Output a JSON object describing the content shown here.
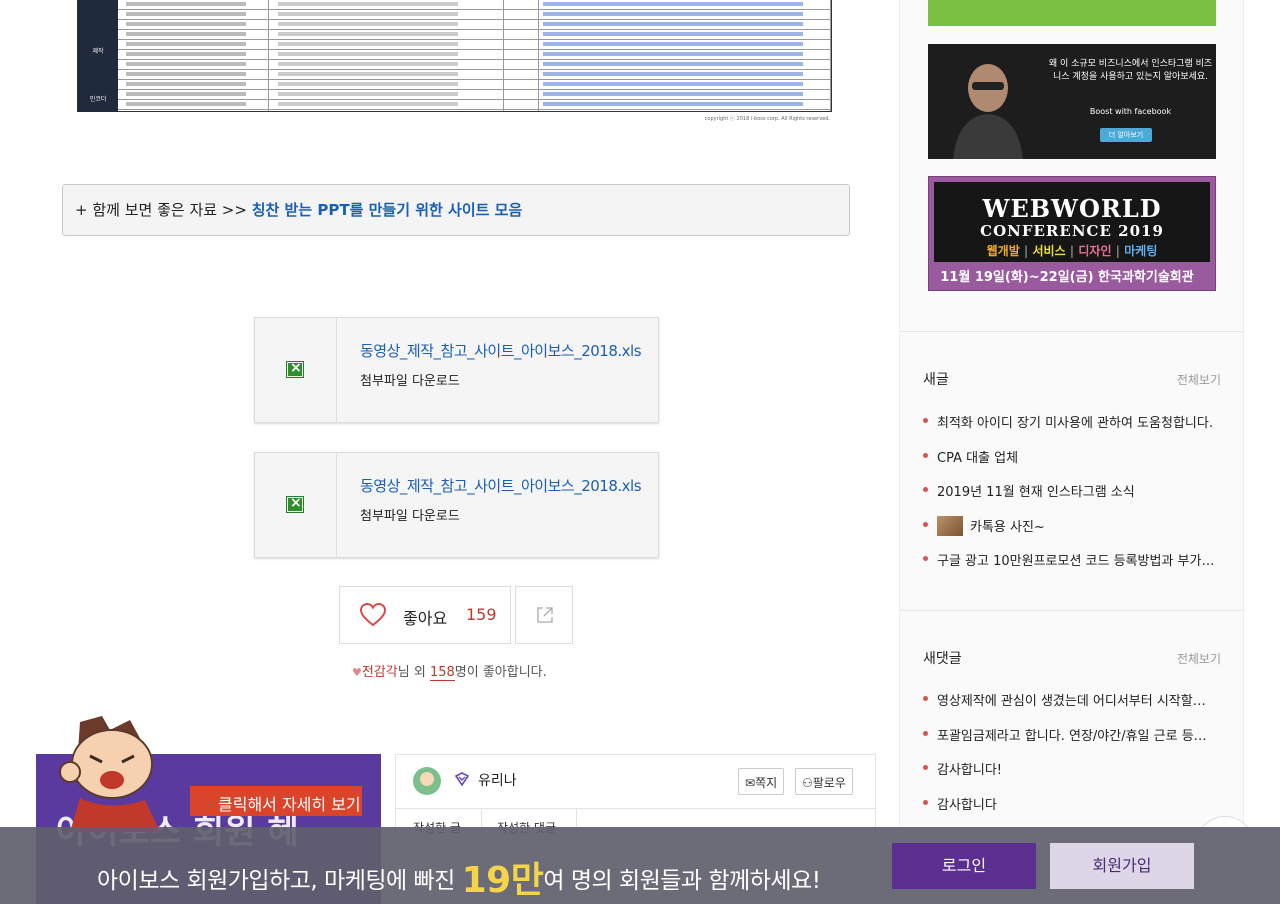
{
  "table_image": {
    "categories": [
      "제작",
      "인코더"
    ],
    "copyright": "copyright ⓒ 2018 i-boss corp. All Rights reserved."
  },
  "related": {
    "prefix": "+ 함께 보면 좋은 자료 >> ",
    "link": "칭찬 받는 PPT를 만들기 위한 사이트 모음"
  },
  "attachments": [
    {
      "filename": "동영상_제작_참고_사이트_아이보스_2018.xls",
      "download_label": "첨부파일 다운로드"
    },
    {
      "filename": "동영상_제작_참고_사이트_아이보스_2018.xls",
      "download_label": "첨부파일 다운로드"
    }
  ],
  "like": {
    "label": "좋아요",
    "count": "159"
  },
  "liked_by": {
    "name": "전감각",
    "mid": "님 외 ",
    "num": "158",
    "suffix": "명이 좋아합니다."
  },
  "promo": {
    "ribbon": "클릭해서 자세히 보기",
    "text": "아이보스 회원 혜"
  },
  "author": {
    "name": "유리나",
    "message_btn": "쪽지",
    "follow_btn": "팔로우",
    "tab1": "작성한 글",
    "tab2": "작성한 댓글"
  },
  "ads": {
    "fb_text": "왜 이 소규모 비즈니스에서 인스타그램 비즈니스 계정을 사용하고 있는지 알아보세요.",
    "fb_brand": "Boost with facebook",
    "fb_button": "더 알아보기",
    "ww_title1": "WEBWORLD",
    "ww_title2": "CONFERENCE 2019",
    "ww_tags": [
      "웹개발",
      "서비스",
      "디자인",
      "마케팅"
    ],
    "ww_date": "11월 19일(화)~22일(금) 한국과학기술회관"
  },
  "sidebar": {
    "new_posts": {
      "title": "새글",
      "more": "전체보기",
      "items": [
        "최적화 아이디 장기 미사용에 관하여 도움청합니다.",
        "CPA 대출 업체",
        "2019년 11월 현재 인스타그램 소식",
        "카톡용 사진~",
        "구글 광고 10만원프로모션 코드 등록방법과 부가…"
      ]
    },
    "new_comments": {
      "title": "새댓글",
      "more": "전체보기",
      "items": [
        "영상제작에 관심이 생겼는데 어디서부터 시작할…",
        "포괄임금제라고 합니다. 연장/야간/휴일 근로 등…",
        "감사합니다!",
        "감사합니다"
      ]
    }
  },
  "bottom_bar": {
    "msg_before": "아이보스 회원가입하고, 마케팅에 빠진 ",
    "highlight": "19만",
    "msg_after": "여 명의 회원들과 함께하세요!",
    "login": "로그인",
    "join": "회원가입"
  },
  "colors": {
    "accent_purple": "#5b2e8f",
    "link_blue": "#1a5fb4",
    "like_red": "#c0392b"
  }
}
